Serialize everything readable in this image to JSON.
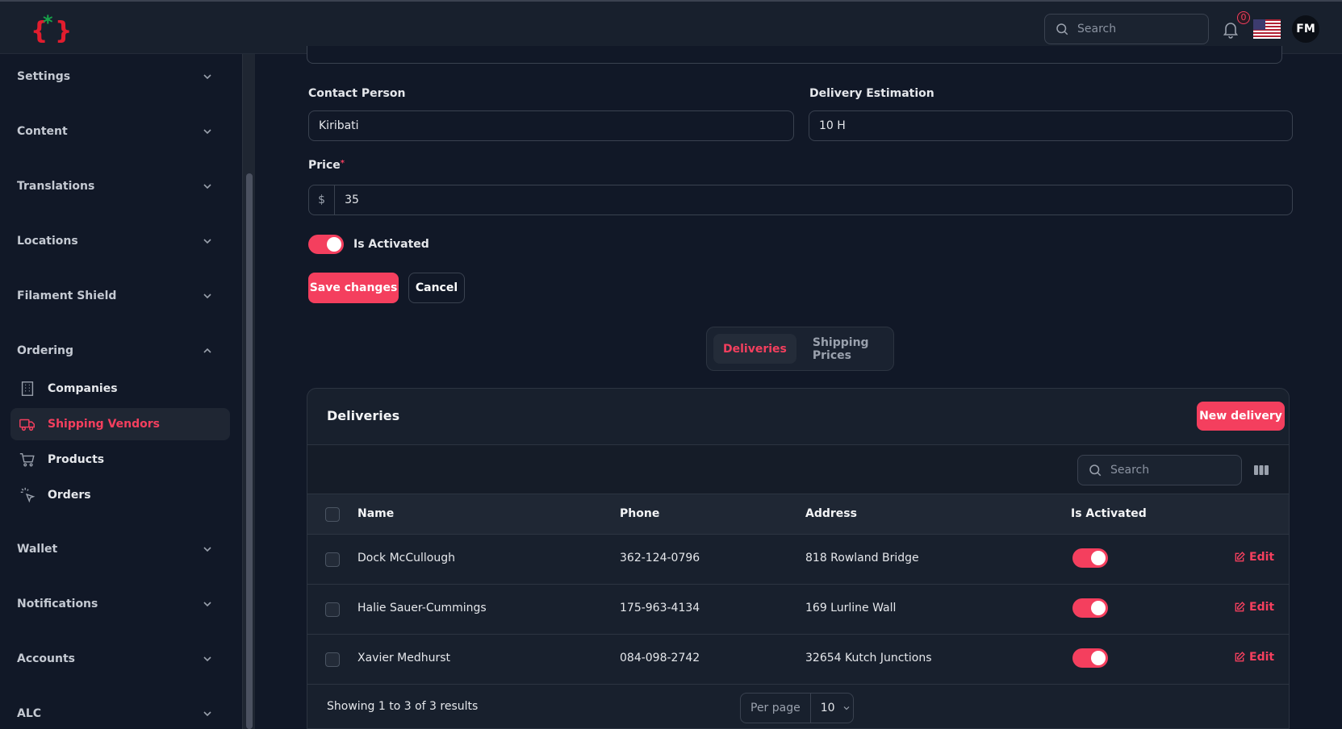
{
  "topbar": {
    "search_placeholder": "Search",
    "notification_count": "0",
    "avatar_initials": "FM"
  },
  "sidebar": {
    "groups": [
      {
        "label": "Settings"
      },
      {
        "label": "Content"
      },
      {
        "label": "Translations"
      },
      {
        "label": "Locations"
      },
      {
        "label": "Filament Shield"
      },
      {
        "label": "Ordering"
      },
      {
        "label": "Wallet"
      },
      {
        "label": "Notifications"
      },
      {
        "label": "Accounts"
      },
      {
        "label": "ALC"
      }
    ],
    "ordering_items": [
      {
        "label": "Companies",
        "icon": "building-icon"
      },
      {
        "label": "Shipping Vendors",
        "icon": "truck-icon",
        "active": true
      },
      {
        "label": "Products",
        "icon": "cart-icon"
      },
      {
        "label": "Orders",
        "icon": "cursor-click-icon"
      }
    ]
  },
  "form": {
    "contact_person_label": "Contact Person",
    "contact_person_value": "Kiribati",
    "delivery_estimation_label": "Delivery Estimation",
    "delivery_estimation_value": "10 H",
    "price_label": "Price",
    "price_required": "*",
    "price_prefix": "$",
    "price_value": "35",
    "is_activated_label": "Is Activated",
    "save_label": "Save changes",
    "cancel_label": "Cancel"
  },
  "tabs": [
    {
      "label": "Deliveries",
      "active": true
    },
    {
      "label": "Shipping Prices"
    }
  ],
  "table": {
    "title": "Deliveries",
    "new_button": "New delivery",
    "search_placeholder": "Search",
    "columns": [
      "Name",
      "Phone",
      "Address",
      "Is Activated"
    ],
    "rows": [
      {
        "name": "Dock McCullough",
        "phone": "362-124-0796",
        "address": "818 Rowland Bridge",
        "activated": true
      },
      {
        "name": "Halie Sauer-Cummings",
        "phone": "175-963-4134",
        "address": "169 Lurline Wall",
        "activated": true
      },
      {
        "name": "Xavier Medhurst",
        "phone": "084-098-2742",
        "address": "32654 Kutch Junctions",
        "activated": true
      }
    ],
    "edit_label": "Edit",
    "footer_text": "Showing 1 to 3 of 3 results",
    "per_page_label": "Per page",
    "per_page_value": "10"
  },
  "colors": {
    "accent": "#f43f5e",
    "background": "#111827",
    "surface": "#18202d"
  }
}
